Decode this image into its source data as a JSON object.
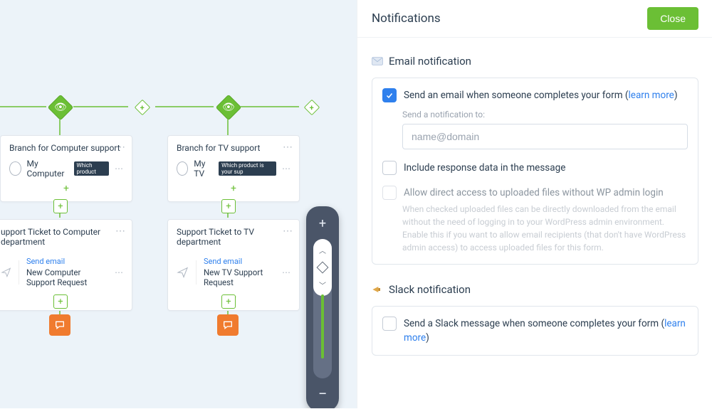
{
  "panel": {
    "title": "Notifications",
    "close": "Close"
  },
  "email": {
    "section_title": "Email notification",
    "send_label_pre": "Send an email when someone completes your form (",
    "send_label_link": "learn more",
    "send_label_post": ")",
    "send_to_label": "Send a notification to:",
    "placeholder": "name@domain",
    "include_label": "Include response data in the message",
    "direct_label": "Allow direct access to uploaded files without WP admin login",
    "direct_note": "When checked uploaded files can be directly downloaded from the email without the need of logging in to your WordPress admin environment. Enable this if you want to allow email recipients (that don't have WordPress admin access) to access uploaded files for this form.",
    "checked": true
  },
  "slack": {
    "section_title": "Slack notification",
    "label_pre": "Send a Slack message when someone completes your form (",
    "label_link": "learn more",
    "label_post": ")"
  },
  "flow": {
    "branch1_title": "Branch for Computer support",
    "branch1_item": "My Computer",
    "branch1_chip": "Which product",
    "branch2_title": "Branch for TV support",
    "branch2_item": "My TV",
    "branch2_chip": "Which product is your sup",
    "ticket1_title": "upport Ticket to Computer department",
    "ticket2_title": "Support Ticket to TV department",
    "mail_label": "Send email",
    "mail1_val": "New Computer Support Request",
    "mail2_val": "New TV Support Request"
  }
}
